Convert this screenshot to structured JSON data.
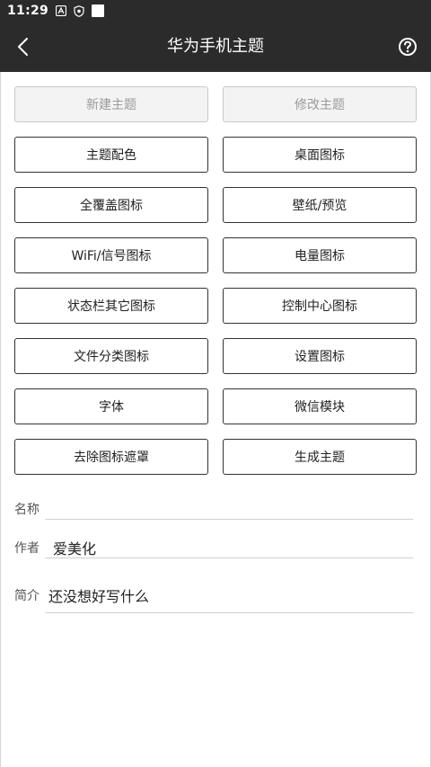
{
  "status_bar": {
    "time": "11:29",
    "icons": [
      "notification-a-icon",
      "shield-icon",
      "blank-square-icon"
    ]
  },
  "app_bar": {
    "title": "华为手机主题",
    "back_icon": "chevron-left-icon",
    "help_icon": "question-circle-icon",
    "background": "#2b2b2b"
  },
  "buttons": [
    {
      "label": "新建主题",
      "enabled": false
    },
    {
      "label": "修改主题",
      "enabled": false
    },
    {
      "label": "主题配色",
      "enabled": true
    },
    {
      "label": "桌面图标",
      "enabled": true
    },
    {
      "label": "全覆盖图标",
      "enabled": true
    },
    {
      "label": "壁纸/预览",
      "enabled": true
    },
    {
      "label": "WiFi/信号图标",
      "enabled": true
    },
    {
      "label": "电量图标",
      "enabled": true
    },
    {
      "label": "状态栏其它图标",
      "enabled": true
    },
    {
      "label": "控制中心图标",
      "enabled": true
    },
    {
      "label": "文件分类图标",
      "enabled": true
    },
    {
      "label": "设置图标",
      "enabled": true
    },
    {
      "label": "字体",
      "enabled": true
    },
    {
      "label": "微信模块",
      "enabled": true
    },
    {
      "label": "去除图标遮罩",
      "enabled": true
    },
    {
      "label": "生成主题",
      "enabled": true
    }
  ],
  "form": {
    "name": {
      "label": "名称",
      "value": ""
    },
    "author": {
      "label": "作者",
      "value": "爱美化"
    },
    "intro": {
      "label": "简介",
      "value": "还没想好写什么"
    }
  }
}
